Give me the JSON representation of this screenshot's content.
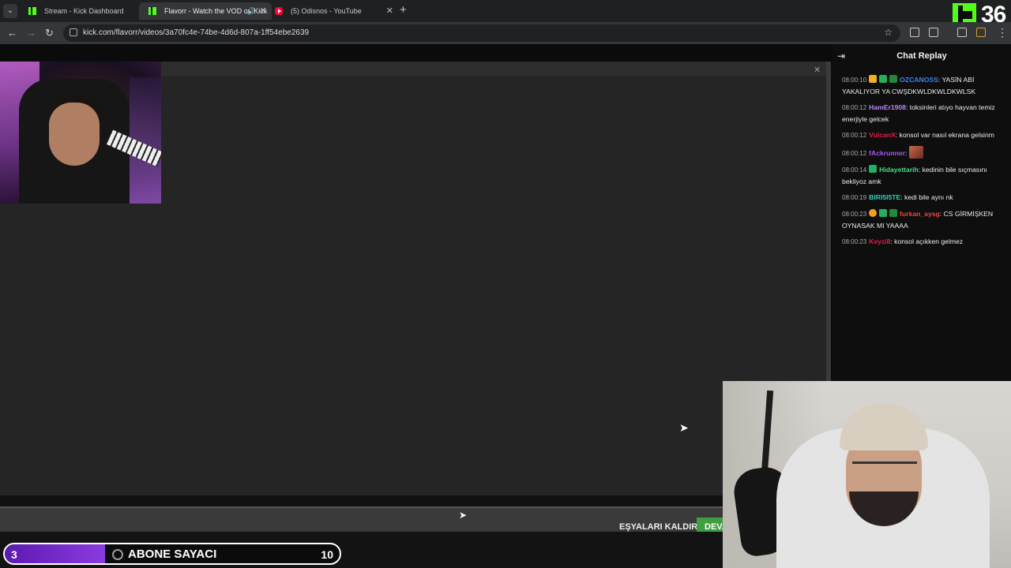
{
  "browser": {
    "tabs": [
      {
        "title": "Stream - Kick Dashboard",
        "favicon": "kick-icon",
        "active": false
      },
      {
        "title": "Flavorr - Watch the VOD on Kick",
        "favicon": "kick-icon",
        "active": true
      },
      {
        "title": "(5) Odisnos - YouTube",
        "favicon": "youtube-icon",
        "active": false
      }
    ],
    "url": "kick.com/flavorr/videos/3a70fc4e-74be-4d6d-807a-1ff54ebe2639",
    "new_tab_label": "+"
  },
  "overlay": {
    "kick_viewer_count": "36"
  },
  "game": {
    "remove_items_label": "EŞYALARI KALDIR",
    "continue_label": "DEVA"
  },
  "sub_counter": {
    "current": "3",
    "label": "ABONE SAYACI",
    "goal": "10",
    "progress": 0.3,
    "fill_color": "#8b3be0"
  },
  "chat": {
    "title": "Chat Replay",
    "messages": [
      {
        "time": "08:00:10",
        "badges": [
          "crown",
          "mod",
          "sub"
        ],
        "user": "OZCANOSS",
        "user_color": "#3b82f6",
        "text": "YASİN ABİ YAKALIYOR YA CWŞDKWLDKWLDKWLSK"
      },
      {
        "time": "08:00:12",
        "badges": [],
        "user": "HamEr1908",
        "user_color": "#c084fc",
        "text": "toksinleri atıyo hayvan temiz enerjiyle gelcek"
      },
      {
        "time": "08:00:12",
        "badges": [],
        "user": "VulcanX",
        "user_color": "#e11d48",
        "text": "konsol var nasıl ekrana gelsinm"
      },
      {
        "time": "08:00:12",
        "badges": [],
        "user": "fAckrunner",
        "user_color": "#a855f7",
        "text": "",
        "emote": true
      },
      {
        "time": "08:00:14",
        "badges": [
          "mod"
        ],
        "user": "Hidayettarih",
        "user_color": "#4ade80",
        "text": "kedinin bile sıçmasını bekliyoz amk"
      },
      {
        "time": "08:00:19",
        "badges": [],
        "user": "BIRI5I5TE",
        "user_color": "#2dd4bf",
        "text": "kedi bile aynı nk"
      },
      {
        "time": "08:00:23",
        "badges": [
          "gift",
          "mod",
          "sub"
        ],
        "user": "furkan_aysg",
        "user_color": "#ef4444",
        "text": "CS GİRMİŞKEN OYNASAK MI YAAAA"
      },
      {
        "time": "08:00:23",
        "badges": [],
        "user": "Keyzi8",
        "user_color": "#e11d48",
        "text": "konsol açıkken gelmez"
      }
    ]
  },
  "colors": {
    "kick_green": "#53fc18",
    "continue_green": "#3f9e3f"
  }
}
